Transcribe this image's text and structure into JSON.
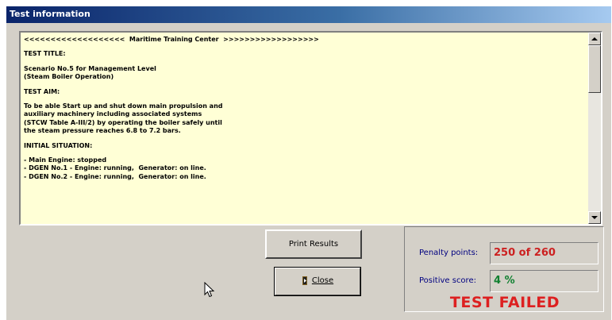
{
  "window": {
    "title": "Test information"
  },
  "report_lines": [
    "<<<<<<<<<<<<<<<<<<<  Maritime Training Center  >>>>>>>>>>>>>>>>>>",
    "",
    "TEST TITLE:",
    "",
    "Scenario No.5 for Management Level",
    "(Steam Boiler Operation)",
    "",
    "TEST AIM:",
    "",
    "To be able Start up and shut down main propulsion and",
    "auxiliary machinery including associated systems",
    "(STCW Table A-III/2) by operating the boiler safely until",
    "the steam pressure reaches 6.8 to 7.2 bars.",
    "",
    "INITIAL SITUATION:",
    "",
    "- Main Engine: stopped",
    "- DGEN No.1 - Engine: running,  Generator: on line.",
    "- DGEN No.2 - Engine: running,  Generator: on line."
  ],
  "buttons": {
    "print_results": "Print Results",
    "close": "Close"
  },
  "score": {
    "penalty_label": "Penalty points:",
    "penalty_value": "250 of 260",
    "positive_label": "Positive score:",
    "positive_value": "4 %",
    "result": "TEST FAILED"
  },
  "colors": {
    "text_background": "#ffffd6",
    "penalty": "#cc2020",
    "positive": "#108030",
    "result": "#dd2020",
    "label": "#000080"
  },
  "icons": {
    "close_button": "door-exit-icon",
    "scroll_up": "arrow-up-icon",
    "scroll_down": "arrow-down-icon"
  }
}
